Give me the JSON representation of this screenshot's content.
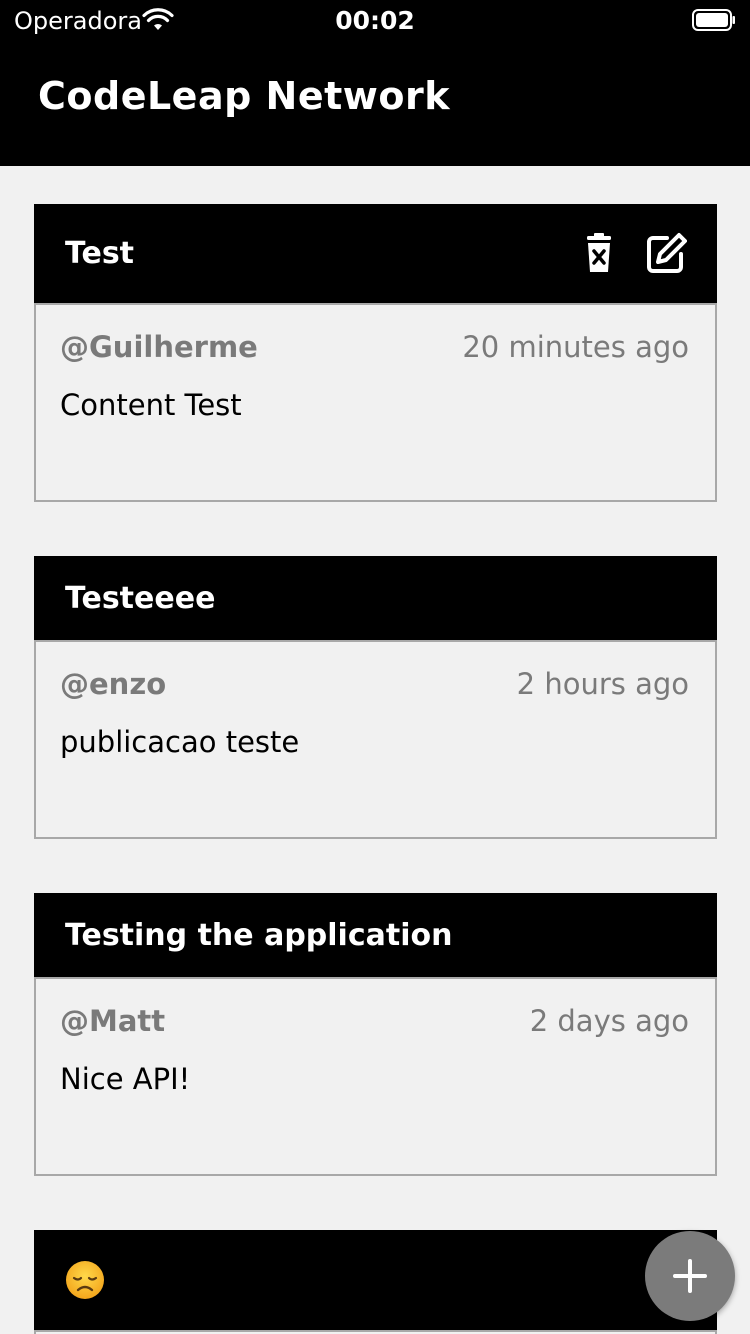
{
  "status_bar": {
    "carrier": "Operadora",
    "time": "00:02"
  },
  "app": {
    "title": "CodeLeap Network"
  },
  "posts": [
    {
      "title": "Test",
      "username": "@Guilherme",
      "time": "20 minutes ago",
      "content": "Content Test",
      "actions": [
        "trash-icon",
        "edit-icon"
      ]
    },
    {
      "title": "Testeeee",
      "username": "@enzo",
      "time": "2 hours ago",
      "content": "publicacao teste"
    },
    {
      "title": "Testing the application",
      "username": "@Matt",
      "time": "2 days ago",
      "content": "Nice API!"
    },
    {
      "title": "",
      "title_icon": "disappointed-face-emoji"
    }
  ],
  "fab": {
    "icon": "plus-icon"
  },
  "colors": {
    "header_bg": "#000000",
    "page_bg": "#f1f1f1",
    "meta_text": "#7a7a7a",
    "fab_bg": "#7b7b7b"
  }
}
